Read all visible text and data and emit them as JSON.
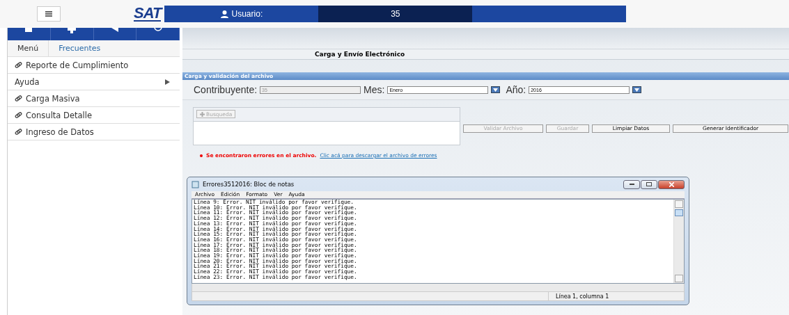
{
  "header": {
    "logo": "SAT",
    "user_label": "Usuario:",
    "user_value": "35"
  },
  "sidebar": {
    "tabs": [
      {
        "label": "Menú",
        "selected": true
      },
      {
        "label": "Frecuentes",
        "selected": false
      }
    ],
    "items": [
      {
        "label": "Reporte de Cumplimiento",
        "kind": "link"
      },
      {
        "label": "Ayuda",
        "kind": "submenu"
      },
      {
        "label": "Carga Masiva",
        "kind": "link"
      },
      {
        "label": "Consulta Detalle",
        "kind": "link"
      },
      {
        "label": "Ingreso de Datos",
        "kind": "link"
      }
    ]
  },
  "page_title": "Carga y Envío Electrónico",
  "section": {
    "title": "Carga y validación del archivo",
    "fields": [
      {
        "label": "Contribuyente:",
        "value": "35",
        "disabled": true,
        "dropdown": false
      },
      {
        "label": "Mes:",
        "value": "Enero",
        "disabled": false,
        "dropdown": true
      },
      {
        "label": "Año:",
        "value": "2016",
        "disabled": false,
        "dropdown": true
      }
    ],
    "search_button": {
      "label": "Busqueda",
      "disabled": true
    },
    "buttons": [
      {
        "label": "Validar Archivo",
        "disabled": true
      },
      {
        "label": "Guardar",
        "disabled": true
      },
      {
        "label": "Limpiar Datos",
        "disabled": false
      },
      {
        "label": "Generar Identificador",
        "disabled": false
      }
    ],
    "error": {
      "message": "Se encontraron errores en el archivo.",
      "link": "Clic acá para descargar el archivo de errores"
    }
  },
  "notepad": {
    "title": "Errores3512016: Bloc de notas",
    "menu": [
      "Archivo",
      "Edición",
      "Formato",
      "Ver",
      "Ayuda"
    ],
    "lines": [
      "Línea 9: Error. NIT inválido por favor verifique.",
      "Línea 10: Error. NIT inválido por favor verifique.",
      "Línea 11: Error. NIT inválido por favor verifique.",
      "Línea 12: Error. NIT inválido por favor verifique.",
      "Línea 13: Error. NIT inválido por favor verifique.",
      "Línea 14: Error. NIT inválido por favor verifique.",
      "Línea 15: Error. NIT inválido por favor verifique.",
      "Línea 16: Error. NIT inválido por favor verifique.",
      "Línea 17: Error. NIT inválido por favor verifique.",
      "Línea 18: Error. NIT inválido por favor verifique.",
      "Línea 19: Error. NIT inválido por favor verifique.",
      "Línea 20: Error. NIT inválido por favor verifique.",
      "Línea 21: Error. NIT inválido por favor verifique.",
      "Línea 22: Error. NIT inválido por favor verifique.",
      "Línea 23: Error. NIT inválido por favor verifique."
    ],
    "status": "Línea 1, columna 1"
  }
}
